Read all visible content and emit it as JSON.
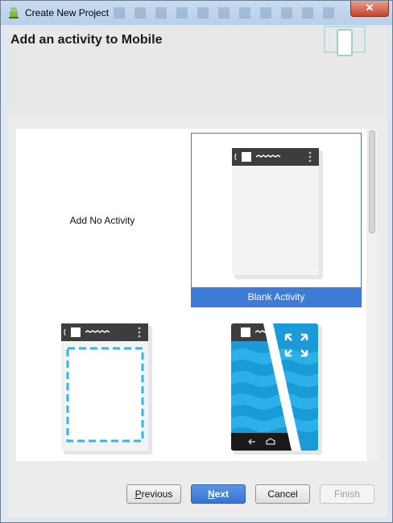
{
  "window": {
    "title": "Create New Project",
    "close_label": "✕"
  },
  "header": {
    "title": "Add an activity to Mobile"
  },
  "gallery": {
    "items": [
      {
        "label": "Add No Activity",
        "selected": false
      },
      {
        "label": "Blank Activity",
        "selected": true
      },
      {
        "label": "",
        "selected": false
      },
      {
        "label": "",
        "selected": false
      }
    ]
  },
  "buttons": {
    "previous": {
      "mnemonic": "P",
      "rest": "revious"
    },
    "next": {
      "mnemonic": "N",
      "rest": "ext"
    },
    "cancel": "Cancel",
    "finish": "Finish"
  },
  "colors": {
    "accent": "#3d7bd6",
    "phone_bar": "#3d3d3d",
    "fragment_dash": "#33b5e5",
    "fullscreen_blue": "#1b9ad8"
  }
}
